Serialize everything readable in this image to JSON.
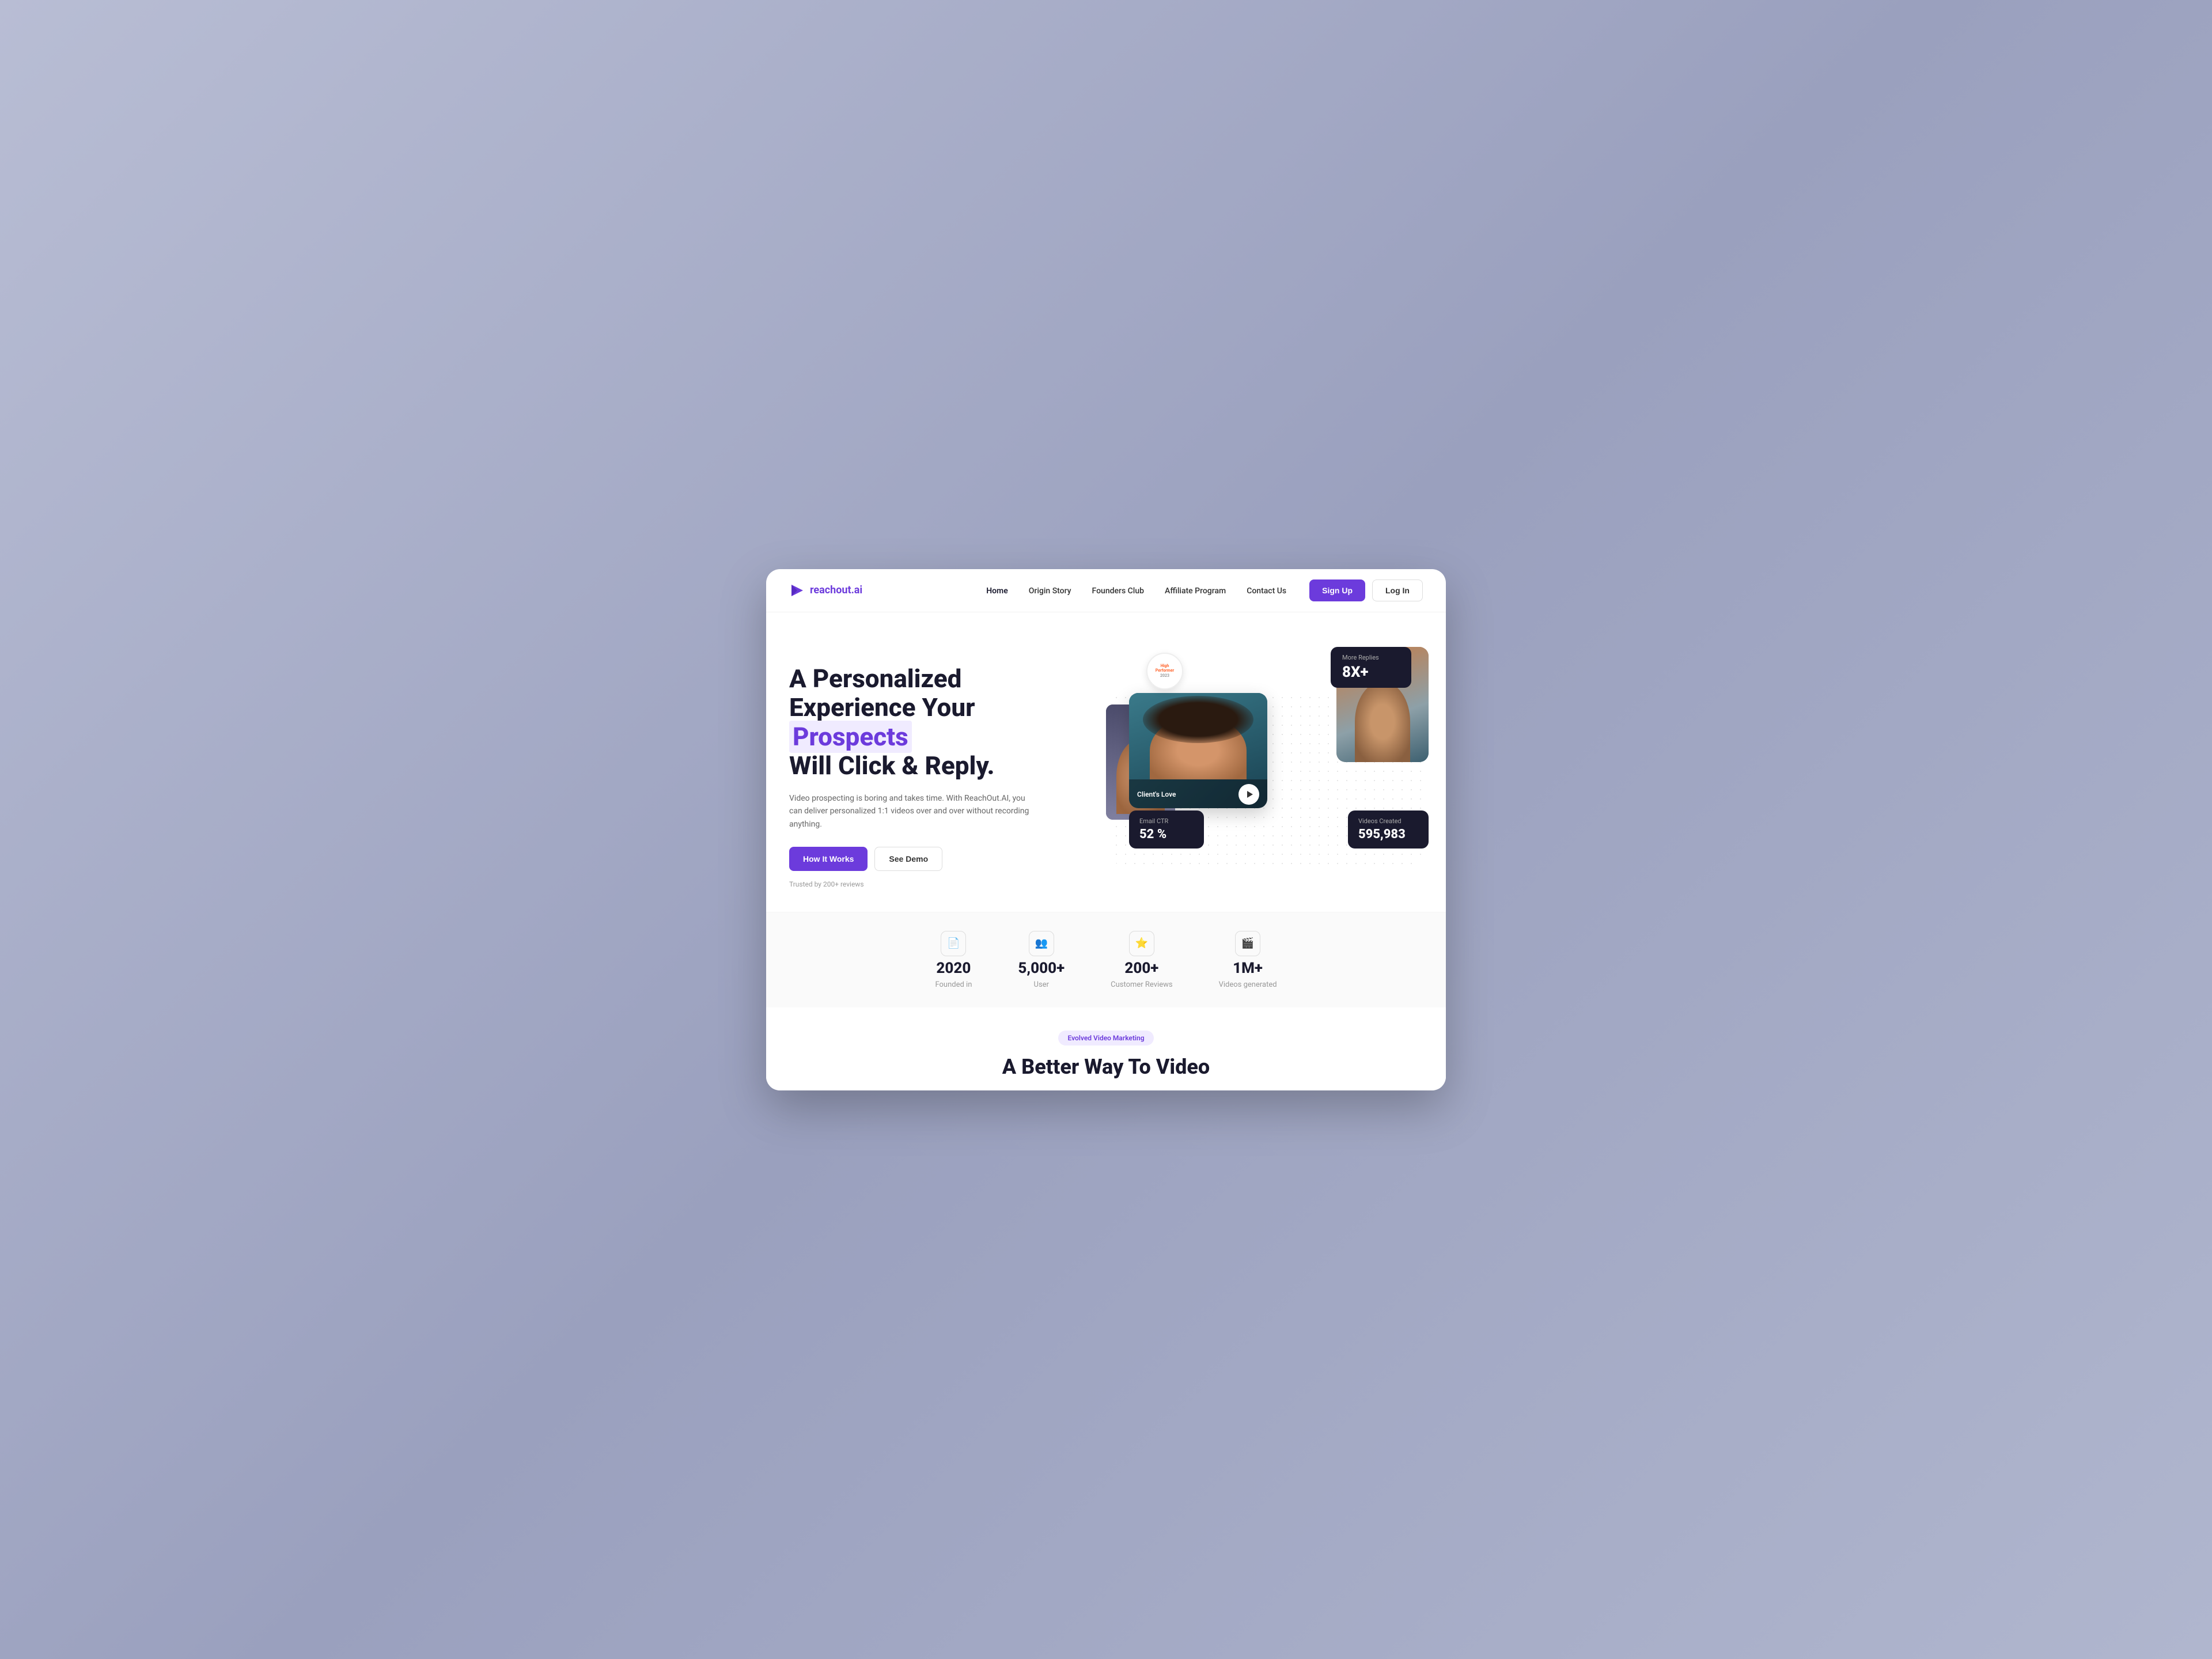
{
  "brand": {
    "name_prefix": "reachout",
    "name_suffix": ".ai",
    "logo_alt": "ReachOut.AI Logo"
  },
  "nav": {
    "links": [
      {
        "label": "Home",
        "active": true
      },
      {
        "label": "Origin Story",
        "active": false
      },
      {
        "label": "Founders Club",
        "active": false
      },
      {
        "label": "Affiliate Program",
        "active": false
      },
      {
        "label": "Contact Us",
        "active": false
      }
    ],
    "signup_label": "Sign Up",
    "login_label": "Log In"
  },
  "hero": {
    "title_line1": "A Personalized",
    "title_line2_prefix": "Experience Your ",
    "title_highlight": "Prospects",
    "title_line3": "Will Click & Reply.",
    "description": "Video prospecting is boring and takes time. With ReachOut.AI, you can deliver personalized 1:1 videos over and over without recording anything.",
    "btn_how": "How It Works",
    "btn_demo": "See Demo",
    "trusted": "Trusted by 200+ reviews"
  },
  "floating_cards": {
    "more_replies_label": "More Replies",
    "more_replies_value": "8X+",
    "clients_love_label": "Client's Love",
    "email_ctr_label": "Email CTR",
    "email_ctr_value": "52 %",
    "videos_created_label": "Videos Created",
    "videos_created_value": "595,983"
  },
  "g2_badge": {
    "line1": "High",
    "line2": "Performer",
    "year": "2023"
  },
  "stats": [
    {
      "icon": "📄",
      "number": "2020",
      "label": "Founded in"
    },
    {
      "icon": "👥",
      "number": "5,000+",
      "label": "User"
    },
    {
      "icon": "⭐",
      "number": "200+",
      "label": "Customer Reviews"
    },
    {
      "icon": "🎬",
      "number": "1M+",
      "label": "Videos generated"
    }
  ],
  "bottom": {
    "evolved_badge": "Evolved Video Marketing",
    "title": "A Better Way To Video"
  }
}
